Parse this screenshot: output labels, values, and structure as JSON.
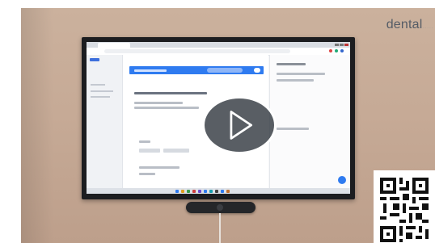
{
  "brand": {
    "text": "dental",
    "faint": "....."
  },
  "video": {
    "play_icon": "play-triangle-icon",
    "overlay_color": "#343a42"
  },
  "screen": {
    "accent": "#2f7bf0",
    "main": {
      "heading": "",
      "bar_color": "#2f7bf0"
    }
  },
  "qr_code": {
    "icon": "qr-code-icon"
  }
}
